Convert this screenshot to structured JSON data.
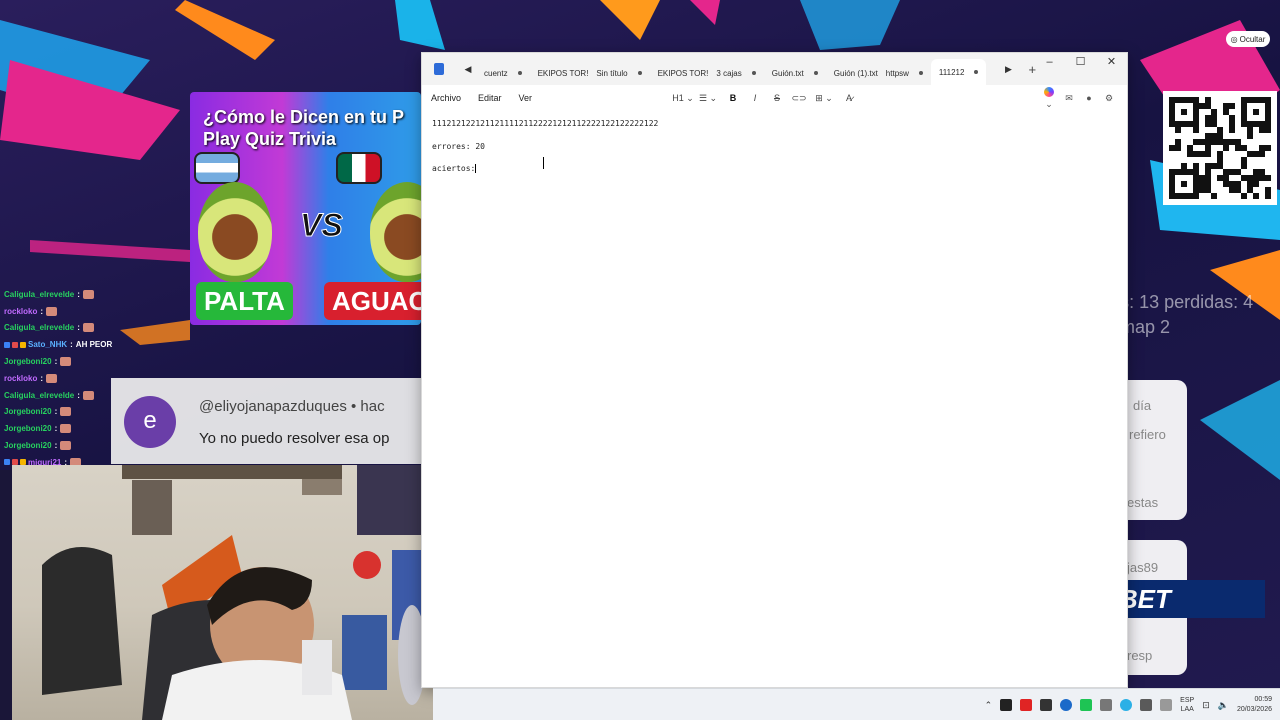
{
  "stream_overlay": {
    "hide_button": "Ocultar",
    "stats_line1": "ganadas: 13 perdidas: 4",
    "stats_line2": "para el map 2",
    "side_cards": [
      "día",
      "refiero",
      "estas",
      "jas89",
      "resp"
    ],
    "sponsor": "1XBET"
  },
  "thumbnail": {
    "title_line1": "¿Cómo le Dicen en tu P",
    "title_line2": "Play Quiz Trivia",
    "vs": "VS",
    "left_label": "PALTA",
    "right_label": "AGUACA"
  },
  "chat": [
    {
      "user": "Caligula_elrevelde",
      "msg": ""
    },
    {
      "user": "rockloko",
      "msg": ""
    },
    {
      "user": "Caligula_elrevelde",
      "msg": ""
    },
    {
      "user": "Sato_NHK",
      "msg": "AH PEOR"
    },
    {
      "user": "Jorgeboni20",
      "msg": ""
    },
    {
      "user": "rockloko",
      "msg": ""
    },
    {
      "user": "Caligula_elrevelde",
      "msg": ""
    },
    {
      "user": "Jorgeboni20",
      "msg": ""
    },
    {
      "user": "Jorgeboni20",
      "msg": ""
    },
    {
      "user": "Jorgeboni20",
      "msg": ""
    },
    {
      "user": "miguri21",
      "msg": ""
    }
  ],
  "comment": {
    "avatar_letter": "e",
    "user": "@eliyojanapazduques  •  hac",
    "text": "Yo no puedo resolver esa op"
  },
  "notepad": {
    "tabs": [
      {
        "label": "cuentz",
        "label2": ""
      },
      {
        "label": "EKIPOS TOR!",
        "label2": "Sin título"
      },
      {
        "label": "EKIPOS TOR!",
        "label2": "3 cajas"
      },
      {
        "label": "Guión.txt",
        "label2": ""
      },
      {
        "label": "Guión (1).txt",
        "label2": "httpsw"
      },
      {
        "label": "111212",
        "label2": ""
      }
    ],
    "menu": {
      "file": "Archivo",
      "edit": "Editar",
      "view": "Ver"
    },
    "heading_selector": "H1",
    "lines": [
      "11121212212112111121122221212112222122122222122",
      "errores: 20",
      "aciertos:"
    ]
  },
  "taskbar": {
    "lang_line1": "ESP",
    "lang_line2": "LAA",
    "time": "00:59",
    "date": "20/03/2026"
  },
  "colors": {
    "chat_user": "#27d15f",
    "notepad_bg": "#ffffff",
    "sponsor_bg": "#0a2a6e"
  }
}
